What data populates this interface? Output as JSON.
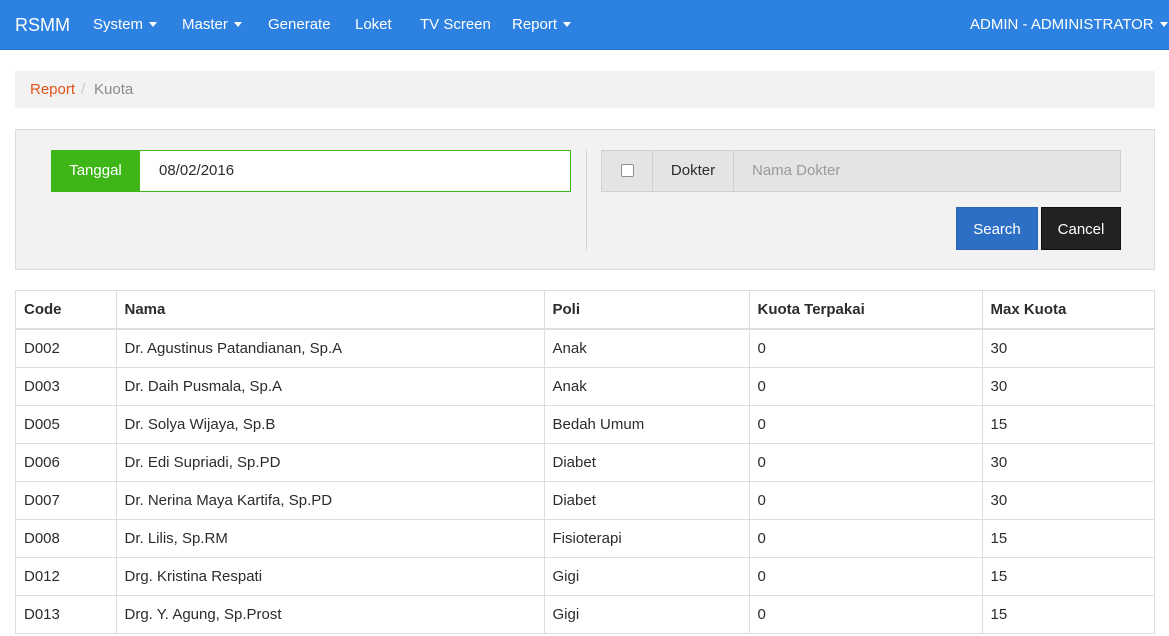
{
  "navbar": {
    "brand": "RSMM",
    "items": [
      {
        "label": "System",
        "dropdown": true
      },
      {
        "label": "Master",
        "dropdown": true
      },
      {
        "label": "Generate",
        "dropdown": false
      },
      {
        "label": "Loket",
        "dropdown": false
      },
      {
        "label": "TV Screen",
        "dropdown": false
      },
      {
        "label": "Report",
        "dropdown": true
      }
    ],
    "user": "ADMIN - ADMINISTRATOR"
  },
  "breadcrumb": {
    "parent": "Report",
    "separator": "/",
    "current": "Kuota"
  },
  "filter": {
    "tanggal_label": "Tanggal",
    "tanggal_value": "08/02/2016",
    "dokter_checked": false,
    "dokter_label": "Dokter",
    "dokter_placeholder": "Nama Dokter",
    "search_label": "Search",
    "cancel_label": "Cancel"
  },
  "table": {
    "columns": [
      "Code",
      "Nama",
      "Poli",
      "Kuota Terpakai",
      "Max Kuota"
    ],
    "rows": [
      [
        "D002",
        "Dr. Agustinus Patandianan, Sp.A",
        "Anak",
        "0",
        "30"
      ],
      [
        "D003",
        "Dr. Daih Pusmala, Sp.A",
        "Anak",
        "0",
        "30"
      ],
      [
        "D005",
        "Dr. Solya Wijaya, Sp.B",
        "Bedah Umum",
        "0",
        "15"
      ],
      [
        "D006",
        "Dr. Edi Supriadi, Sp.PD",
        "Diabet",
        "0",
        "30"
      ],
      [
        "D007",
        "Dr. Nerina Maya Kartifa, Sp.PD",
        "Diabet",
        "0",
        "30"
      ],
      [
        "D008",
        "Dr. Lilis, Sp.RM",
        "Fisioterapi",
        "0",
        "15"
      ],
      [
        "D012",
        "Drg. Kristina Respati",
        "Gigi",
        "0",
        "15"
      ],
      [
        "D013",
        "Drg. Y. Agung, Sp.Prost",
        "Gigi",
        "0",
        "15"
      ]
    ]
  },
  "colors": {
    "navbar": "#2d81e0",
    "success": "#3fb618",
    "primary": "#2d6fc4",
    "link": "#e1531c",
    "dark": "#222222"
  }
}
